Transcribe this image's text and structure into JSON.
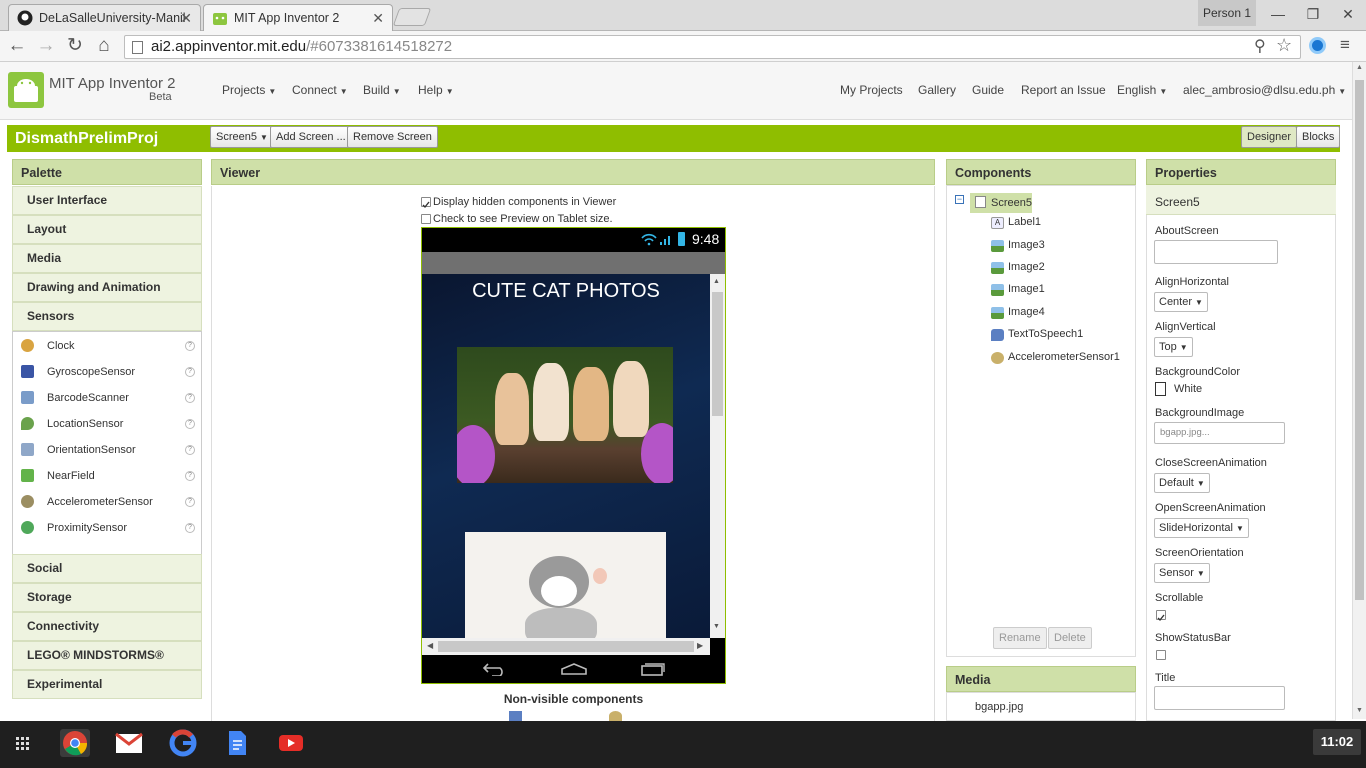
{
  "browser": {
    "tabs": [
      {
        "title": "DeLaSalleUniversity-Manil",
        "icon": "github-icon"
      },
      {
        "title": "MIT App Inventor 2",
        "icon": "app-inventor-icon"
      }
    ],
    "profile": "Person 1",
    "url_host": "ai2.appinventor.mit.edu",
    "url_path": "/#6073381614518272"
  },
  "app": {
    "title": "MIT App Inventor 2",
    "beta": "Beta",
    "menus": [
      "Projects",
      "Connect",
      "Build",
      "Help"
    ],
    "right_links": [
      "My Projects",
      "Gallery",
      "Guide",
      "Report an Issue",
      "English",
      "alec_ambrosio@dlsu.edu.ph"
    ]
  },
  "project": {
    "name": "DismathPrelimProj",
    "screen_select": "Screen5",
    "add_screen": "Add Screen ...",
    "remove_screen": "Remove Screen",
    "designer": "Designer",
    "blocks": "Blocks"
  },
  "palette": {
    "title": "Palette",
    "categories_top": [
      "User Interface",
      "Layout",
      "Media",
      "Drawing and Animation",
      "Sensors"
    ],
    "items": [
      {
        "label": "Clock",
        "icon": "clock-icon",
        "color": "#d9a441"
      },
      {
        "label": "GyroscopeSensor",
        "icon": "gyroscope-icon",
        "color": "#3a55a5"
      },
      {
        "label": "BarcodeScanner",
        "icon": "barcode-icon",
        "color": "#7a9cc9"
      },
      {
        "label": "LocationSensor",
        "icon": "location-pin-icon",
        "color": "#6aa24c"
      },
      {
        "label": "OrientationSensor",
        "icon": "orientation-icon",
        "color": "#8fa7c8"
      },
      {
        "label": "NearField",
        "icon": "nearfield-icon",
        "color": "#63b34a"
      },
      {
        "label": "AccelerometerSensor",
        "icon": "accelerometer-icon",
        "color": "#9b8e62"
      },
      {
        "label": "ProximitySensor",
        "icon": "proximity-icon",
        "color": "#4fa85a"
      }
    ],
    "categories_bottom": [
      "Social",
      "Storage",
      "Connectivity",
      "LEGO® MINDSTORMS®",
      "Experimental"
    ]
  },
  "viewer": {
    "title": "Viewer",
    "display_hidden": "Display hidden components in Viewer",
    "display_hidden_checked": true,
    "tablet_preview": "Check to see Preview on Tablet size.",
    "tablet_preview_checked": false,
    "phone_time": "9:48",
    "screen_label": "CUTE CAT PHOTOS",
    "nonvisible_title": "Non-visible components"
  },
  "components": {
    "title": "Components",
    "root": "Screen5",
    "children": [
      {
        "label": "Label1",
        "icon": "label-icon"
      },
      {
        "label": "Image3",
        "icon": "image-icon"
      },
      {
        "label": "Image2",
        "icon": "image-icon"
      },
      {
        "label": "Image1",
        "icon": "image-icon"
      },
      {
        "label": "Image4",
        "icon": "image-icon"
      },
      {
        "label": "TextToSpeech1",
        "icon": "speech-icon"
      },
      {
        "label": "AccelerometerSensor1",
        "icon": "accelerometer-icon"
      }
    ],
    "rename": "Rename",
    "delete": "Delete"
  },
  "media": {
    "title": "Media",
    "files": [
      "bgapp.jpg"
    ]
  },
  "properties": {
    "title": "Properties",
    "component": "Screen5",
    "about_label": "AboutScreen",
    "alignh_label": "AlignHorizontal",
    "alignh_value": "Center",
    "alignv_label": "AlignVertical",
    "alignv_value": "Top",
    "bgcolor_label": "BackgroundColor",
    "bgcolor_value": "White",
    "bgimage_label": "BackgroundImage",
    "bgimage_value": "bgapp.jpg...",
    "closeanim_label": "CloseScreenAnimation",
    "closeanim_value": "Default",
    "openanim_label": "OpenScreenAnimation",
    "openanim_value": "SlideHorizontal",
    "orientation_label": "ScreenOrientation",
    "orientation_value": "Sensor",
    "scrollable_label": "Scrollable",
    "scrollable_checked": true,
    "statusbar_label": "ShowStatusBar",
    "statusbar_checked": false,
    "title_label": "Title"
  },
  "taskbar": {
    "time": "11:02",
    "apps": [
      "apps-grid-icon",
      "chrome-icon",
      "gmail-icon",
      "google-icon",
      "docs-icon",
      "youtube-icon"
    ]
  },
  "colors": {
    "accent_green": "#8fbe00",
    "panel_header": "#cfe0a8"
  }
}
